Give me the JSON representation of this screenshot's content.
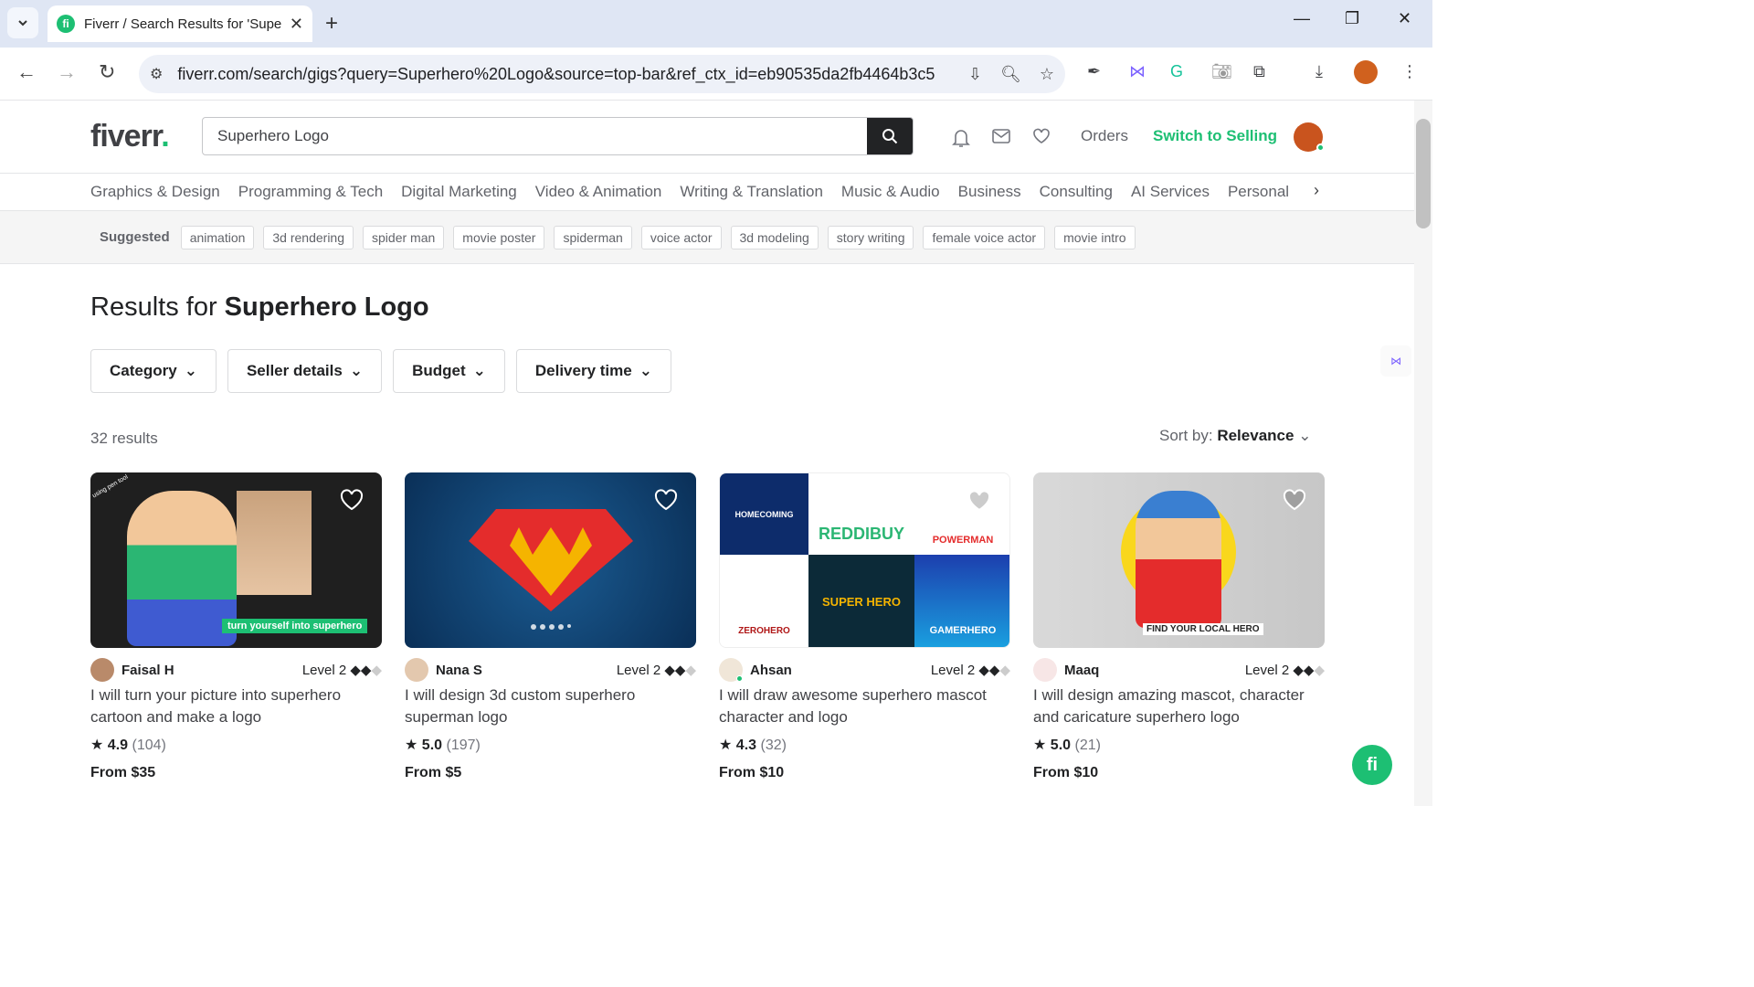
{
  "browser": {
    "tab_title": "Fiverr / Search Results for 'Supe",
    "url": "fiverr.com/search/gigs?query=Superhero%20Logo&source=top-bar&ref_ctx_id=eb90535da2fb4464b3c5..."
  },
  "header": {
    "logo": "fiverr",
    "logo_dot": ".",
    "search_value": "Superhero Logo",
    "orders": "Orders",
    "switch": "Switch to Selling"
  },
  "categories": [
    "Graphics & Design",
    "Programming & Tech",
    "Digital Marketing",
    "Video & Animation",
    "Writing & Translation",
    "Music & Audio",
    "Business",
    "Consulting",
    "AI Services",
    "Personal"
  ],
  "suggested": {
    "label": "Suggested",
    "chips": [
      "animation",
      "3d rendering",
      "spider man",
      "movie poster",
      "spiderman",
      "voice actor",
      "3d modeling",
      "story writing",
      "female voice actor",
      "movie intro"
    ]
  },
  "results": {
    "prefix": "Results for",
    "query": "Superhero Logo",
    "count": "32 results",
    "sort_label": "Sort by:",
    "sort_value": "Relevance"
  },
  "filters": [
    "Category",
    "Seller details",
    "Budget",
    "Delivery time"
  ],
  "cards": [
    {
      "seller": "Faisal H",
      "level": "Level 2",
      "title": "I will turn your picture into superhero cartoon and make a logo",
      "rating": "4.9",
      "reviews": "(104)",
      "price": "From $35",
      "thumb_text": "turn yourself into superhero",
      "thumb_text2": "using pen tool"
    },
    {
      "seller": "Nana S",
      "level": "Level 2",
      "title": "I will design 3d custom superhero superman logo",
      "rating": "5.0",
      "reviews": "(197)",
      "price": "From $5"
    },
    {
      "seller": "Ahsan",
      "level": "Level 2",
      "title": "I will draw awesome superhero mascot character and logo",
      "rating": "4.3",
      "reviews": "(32)",
      "price": "From $10",
      "tiles": [
        "HOMECOMING",
        "REDDIBUY",
        "POWERMAN",
        "ZEROHERO",
        "SUPER HERO",
        "GAMERHERO"
      ]
    },
    {
      "seller": "Maaq",
      "level": "Level 2",
      "title": "I will design amazing mascot, character and caricature superhero logo",
      "rating": "5.0",
      "reviews": "(21)",
      "price": "From $10",
      "thumb_text": "FIND YOUR LOCAL HERO"
    }
  ],
  "colors": {
    "brand": "#1dbf73",
    "text": "#404145"
  }
}
